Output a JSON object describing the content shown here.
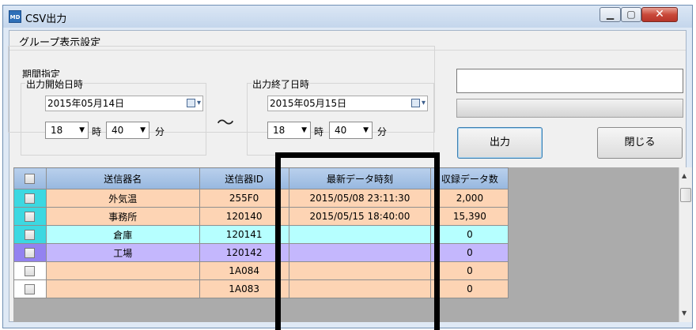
{
  "window": {
    "title": "CSV出力"
  },
  "menu": {
    "group_display": "グループ表示設定"
  },
  "period": {
    "label": "期間指定",
    "start": {
      "label": "出力開始日時",
      "date": "2015年05月14日",
      "hour": "18",
      "minute": "40"
    },
    "end": {
      "label": "出力終了日時",
      "date": "2015年05月15日",
      "hour": "18",
      "minute": "40"
    },
    "hour_unit": "時",
    "minute_unit": "分",
    "separator": "〜"
  },
  "output": {
    "text_value": "",
    "button_label": "出力",
    "close_label": "閉じる"
  },
  "grid": {
    "columns": [
      "",
      "送信器名",
      "送信器ID",
      "最新データ時刻",
      "収録データ数"
    ],
    "rows": [
      {
        "name": "外気温",
        "id": "255F0",
        "latest": "2015/05/08 23:11:30",
        "count": "2,000",
        "color": "peach"
      },
      {
        "name": "事務所",
        "id": "120140",
        "latest": "2015/05/15 18:40:00",
        "count": "15,390",
        "color": "peach"
      },
      {
        "name": "倉庫",
        "id": "120141",
        "latest": "",
        "count": "0",
        "color": "cyan"
      },
      {
        "name": "工場",
        "id": "120142",
        "latest": "",
        "count": "0",
        "color": "purple"
      },
      {
        "name": "",
        "id": "1A084",
        "latest": "",
        "count": "0",
        "color": "peach"
      },
      {
        "name": "",
        "id": "1A083",
        "latest": "",
        "count": "0",
        "color": "peach"
      }
    ]
  },
  "colors": {
    "peach": "#fdd4b4",
    "cyan": "#b6ffff",
    "purple": "#c4b7fd",
    "header": "#a3c0e4"
  }
}
